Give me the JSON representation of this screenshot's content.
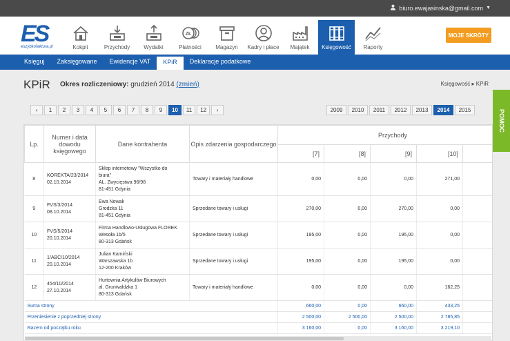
{
  "user": {
    "email": "biuro.ewajasinska@gmail.com"
  },
  "logo": {
    "mark": "ES",
    "sub": "eszybkofaktura.pl"
  },
  "nav": [
    {
      "label": "Kokpit",
      "icon": "house-icon"
    },
    {
      "label": "Przychody",
      "icon": "inbox-in-icon"
    },
    {
      "label": "Wydatki",
      "icon": "outbox-icon"
    },
    {
      "label": "Płatności",
      "icon": "coins-icon",
      "coin_text": "ZŁ"
    },
    {
      "label": "Magazyn",
      "icon": "box-icon"
    },
    {
      "label": "Kadry i płace",
      "icon": "person-icon"
    },
    {
      "label": "Majątek",
      "icon": "factory-icon"
    },
    {
      "label": "Księgowość",
      "icon": "books-icon"
    },
    {
      "label": "Raporty",
      "icon": "line-chart-icon"
    }
  ],
  "moje_skroty": "MOJE SKRÓTY",
  "subnav": [
    "Księguj",
    "Zaksięgowane",
    "Ewidencje VAT",
    "KPiR",
    "Deklaracje podatkowe"
  ],
  "title": "KPiR",
  "period": {
    "label": "Okres rozliczeniowy:",
    "value": "grudzień 2014",
    "change": "(zmień)"
  },
  "breadcrumb": {
    "parent": "Księgowość",
    "sep": "▸",
    "current": "KPiR"
  },
  "pomoc": "POMOC",
  "pagination": {
    "prev": "‹",
    "next": "›",
    "pages": [
      "1",
      "2",
      "3",
      "4",
      "5",
      "6",
      "7",
      "8",
      "9",
      "10",
      "11",
      "12"
    ],
    "active": "10"
  },
  "years": {
    "items": [
      "2009",
      "2010",
      "2011",
      "2012",
      "2013",
      "2014",
      "2015"
    ],
    "active": "2014"
  },
  "table": {
    "headers": {
      "lp": "Lp.",
      "numer": "Numer i data dowodu księgowego",
      "kontrahent": "Dane kontrahenta",
      "opis": "Opis zdarzenia gospodarczego",
      "przychody": "Przychody"
    },
    "subheaders": [
      "[7]",
      "[8]",
      "[9]",
      "[10]",
      "[1"
    ],
    "rows": [
      {
        "lp": "8",
        "doc": [
          "KOREKTA/23/2014",
          "02.10.2014"
        ],
        "kontrahent": [
          "Sklep internetowy \"Wszystko do",
          "biura\"",
          "AL. Zwycięstwa 96/98",
          "81-451 Gdynia"
        ],
        "opis": "Towary i materiały handlowe",
        "c7": "0,00",
        "c8": "0,00",
        "c9": "0,00",
        "c10": "271,00"
      },
      {
        "lp": "9",
        "doc": [
          "FVS/3/2014",
          "08.10.2014"
        ],
        "kontrahent": [
          "Ewa Nowak",
          "Grodzka 11",
          "81-451 Gdynia"
        ],
        "opis": "Sprzedane towary i usługi",
        "c7": "270,00",
        "c8": "0,00",
        "c9": "270,00",
        "c10": "0,00"
      },
      {
        "lp": "10",
        "doc": [
          "FVS/5/2014",
          "20.10.2014"
        ],
        "kontrahent": [
          "Firma Handlowo-Usługowa FLOREK",
          "Wesoła 1b/5",
          "80-313 Gdańsk"
        ],
        "opis": "Sprzedane towary i usługi",
        "c7": "195,00",
        "c8": "0,00",
        "c9": "195,00",
        "c10": "0,00"
      },
      {
        "lp": "11",
        "doc": [
          "1/ABC/10/2014",
          "20.10.2014"
        ],
        "kontrahent": [
          "Julian Kamiński",
          "Warszawska 1b",
          "12-200 Kraków"
        ],
        "opis": "Sprzedane towary i usługi",
        "c7": "195,00",
        "c8": "0,00",
        "c9": "195,00",
        "c10": "0,00"
      },
      {
        "lp": "12",
        "doc": [
          "454/10/2014",
          "27.10.2014"
        ],
        "kontrahent": [
          "Hurtownia Artykułów Biurowych",
          "al. Grunwaldzka 1",
          "80-313 Gdańsk"
        ],
        "opis": "Towary i materiały handlowe",
        "c7": "0,00",
        "c8": "0,00",
        "c9": "0,00",
        "c10": "162,25"
      }
    ],
    "sums": [
      {
        "label": "Suma strony",
        "c7": "660,00",
        "c8": "0,00",
        "c9": "660,00",
        "c10": "433,25"
      },
      {
        "label": "Przeniesienie z poprzedniej strony",
        "c7": "2 500,00",
        "c8": "2 500,00",
        "c9": "2 500,00",
        "c10": "2 785,85"
      },
      {
        "label": "Razem od początku roku",
        "c7": "3 160,00",
        "c8": "0,00",
        "c9": "3 160,00",
        "c10": "3 219,10"
      }
    ]
  },
  "colors": {
    "brand": "#1c5fae",
    "accent": "#f39c1f",
    "help": "#7cb928"
  }
}
